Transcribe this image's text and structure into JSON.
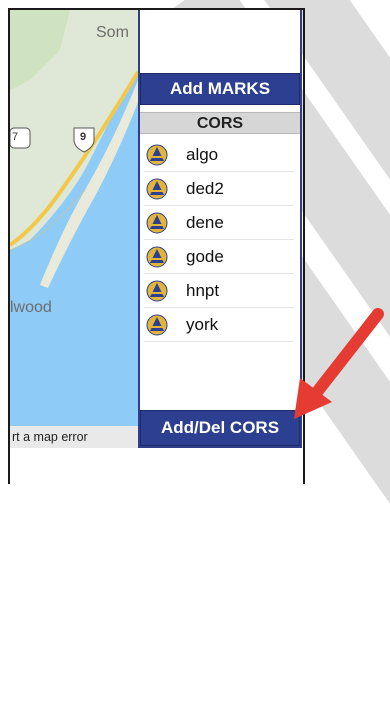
{
  "map": {
    "place_top": "Som",
    "place_bottom": "lwood",
    "shield_left": "7",
    "shield_right": "9",
    "error_link": "rt a map error"
  },
  "panel": {
    "add_marks_label": "Add MARKS",
    "cors_header": "CORS",
    "cors_items": [
      "algo",
      "ded2",
      "dene",
      "gode",
      "hnpt",
      "york"
    ],
    "add_del_label": "Add/Del CORS"
  },
  "colors": {
    "button_bg": "#2c3f91",
    "icon_fill": "#e0b53a",
    "icon_mark": "#2c3f91",
    "arrow": "#e43b32"
  }
}
